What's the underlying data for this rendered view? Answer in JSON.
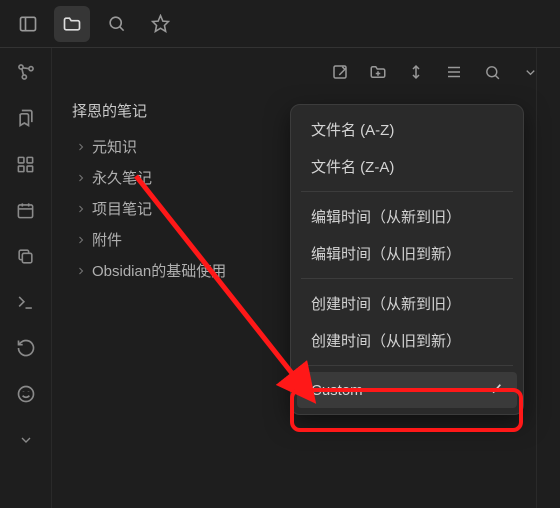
{
  "topBar": {
    "icons": [
      "sidebar-icon",
      "folder-icon",
      "search-icon",
      "star-icon"
    ]
  },
  "activityBar": {
    "icons": [
      "graph-icon",
      "bookmark-alt-icon",
      "grid-icon",
      "calendar-icon",
      "copy-icon",
      "terminal-icon",
      "history-icon",
      "smile-icon",
      "chevron-down-icon"
    ]
  },
  "fileToolbar": {
    "icons": [
      "new-note-icon",
      "new-folder-icon",
      "sort-icon",
      "collapse-icon",
      "search-icon",
      "chevron-down-icon"
    ]
  },
  "vault": {
    "title": "择恩的笔记"
  },
  "folders": [
    {
      "name": "元知识"
    },
    {
      "name": "永久笔记"
    },
    {
      "name": "项目笔记"
    },
    {
      "name": "附件"
    },
    {
      "name": "Obsidian的基础使用"
    }
  ],
  "sortMenu": {
    "groups": [
      [
        {
          "label": "文件名 (A-Z)",
          "selected": false
        },
        {
          "label": "文件名 (Z-A)",
          "selected": false
        }
      ],
      [
        {
          "label": "编辑时间（从新到旧）",
          "selected": false
        },
        {
          "label": "编辑时间（从旧到新）",
          "selected": false
        }
      ],
      [
        {
          "label": "创建时间（从新到旧）",
          "selected": false
        },
        {
          "label": "创建时间（从旧到新）",
          "selected": false
        }
      ],
      [
        {
          "label": "Custom",
          "selected": true
        }
      ]
    ]
  },
  "annotation": {
    "highlight": "Custom sort option highlighted",
    "colors": {
      "highlight": "#ff1818"
    }
  }
}
